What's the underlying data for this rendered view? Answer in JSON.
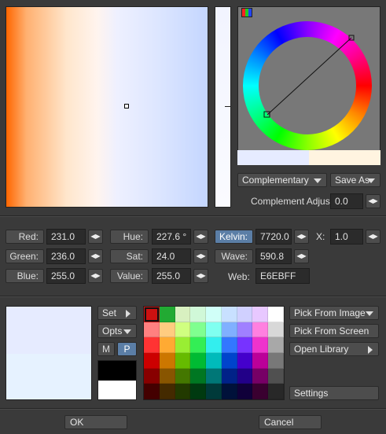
{
  "picker": {
    "harmony_mode": "Complementary",
    "save_as_label": "Save As",
    "complement_adjust_label": "Complement Adjust:",
    "complement_adjust_value": "0.0"
  },
  "rgb": {
    "red_label": "Red:",
    "red_value": "231.0",
    "green_label": "Green:",
    "green_value": "236.0",
    "blue_label": "Blue:",
    "blue_value": "255.0"
  },
  "hsv": {
    "hue_label": "Hue:",
    "hue_value": "227.6 °",
    "sat_label": "Sat:",
    "sat_value": "24.0",
    "value_label": "Value:",
    "value_value": "255.0"
  },
  "kelvin": {
    "kelvin_label": "Kelvin:",
    "kelvin_value": "7720.0",
    "x_label": "X:",
    "x_value": "1.0",
    "wave_label": "Wave:",
    "wave_value": "590.8",
    "web_label": "Web:",
    "web_value": "E6EBFF"
  },
  "swatch_tools": {
    "set_label": "Set",
    "opts_label": "Opts",
    "m_label": "M",
    "p_label": "P"
  },
  "right_menu": {
    "pick_from_image": "Pick From Image",
    "pick_from_screen": "Pick From Screen",
    "open_library": "Open Library",
    "settings": "Settings"
  },
  "footer": {
    "ok_label": "OK",
    "cancel_label": "Cancel"
  },
  "colors": {
    "current": "#e6ebff",
    "previous": "#e6f2ff",
    "complement": "#fff4e0",
    "kelvin_active": "#5b7ea6",
    "palette": [
      [
        "#cc1111",
        "#22aa33",
        "#d8f0c0",
        "#d0f8d8",
        "#d0fff8",
        "#c8e0ff",
        "#d0d0ff",
        "#e8c8ff",
        "#ffffff"
      ],
      [
        "#ff8080",
        "#ffcc80",
        "#d0ff80",
        "#80ff90",
        "#80fff0",
        "#80b0ff",
        "#a080ff",
        "#ff80e0",
        "#d8d8d8"
      ],
      [
        "#ff3333",
        "#ffaa33",
        "#99ee33",
        "#33ee55",
        "#33eeee",
        "#3377ff",
        "#7733ff",
        "#ee33cc",
        "#a8a8a8"
      ],
      [
        "#cc0000",
        "#cc7700",
        "#66bb00",
        "#00bb33",
        "#00bbbb",
        "#0044cc",
        "#4400cc",
        "#bb0099",
        "#787878"
      ],
      [
        "#880000",
        "#885500",
        "#447700",
        "#007722",
        "#007777",
        "#002288",
        "#220088",
        "#770066",
        "#505050"
      ],
      [
        "#440000",
        "#442a00",
        "#223a00",
        "#003a10",
        "#003a3a",
        "#00113a",
        "#10003a",
        "#3a0030",
        "#282828"
      ]
    ]
  }
}
